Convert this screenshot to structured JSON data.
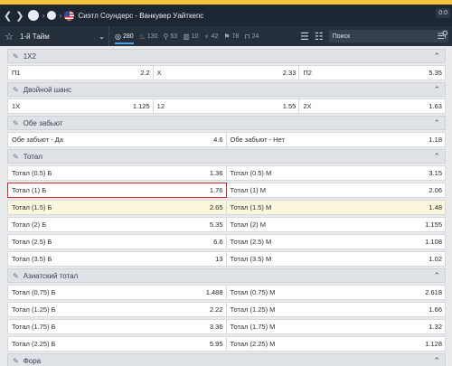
{
  "header": {
    "title": "Сиэтл Соундерс - Ванкувер Уайткепс",
    "timer": "0:0",
    "icons": [
      "chevron-left-icon",
      "chevron-right-icon",
      "sport-icon",
      "league-icon",
      "usa-flag-icon"
    ]
  },
  "toolbar": {
    "period_label": "1-й Тайм",
    "markets": [
      {
        "icon": "target-icon",
        "count": "280"
      },
      {
        "icon": "flame-icon",
        "count": "130"
      },
      {
        "icon": "stats-icon",
        "count": "53"
      },
      {
        "icon": "chart-icon",
        "count": "10"
      },
      {
        "icon": "trophy-icon",
        "count": "42"
      },
      {
        "icon": "flag-icon",
        "count": "78"
      },
      {
        "icon": "goal-icon",
        "count": "24"
      }
    ],
    "search_placeholder": "Поиск"
  },
  "sections": [
    {
      "title": "1X2",
      "rows": [
        [
          {
            "label": "П1",
            "odd": "2.2"
          },
          {
            "label": "Х",
            "odd": "2.33"
          },
          {
            "label": "П2",
            "odd": "5.35"
          }
        ]
      ]
    },
    {
      "title": "Двойной шанс",
      "rows": [
        [
          {
            "label": "1Х",
            "odd": "1.125"
          },
          {
            "label": "12",
            "odd": "1.55"
          },
          {
            "label": "2Х",
            "odd": "1.63"
          }
        ]
      ]
    },
    {
      "title": "Обе забьют",
      "rows": [
        [
          {
            "label": "Обе забьют - Да",
            "odd": "4.6"
          },
          {
            "label": "Обе забьют - Нет",
            "odd": "1.18"
          }
        ]
      ]
    },
    {
      "title": "Тотал",
      "rows": [
        [
          {
            "label": "Тотал (0.5) Б",
            "odd": "1.36"
          },
          {
            "label": "Тотал (0.5) М",
            "odd": "3.15"
          }
        ],
        [
          {
            "label": "Тотал (1) Б",
            "odd": "1.76"
          },
          {
            "label": "Тотал (1) М",
            "odd": "2.06"
          }
        ],
        [
          {
            "label": "Тотал (1.5) Б",
            "odd": "2.65"
          },
          {
            "label": "Тотал (1.5) М",
            "odd": "1.48"
          }
        ],
        [
          {
            "label": "Тотал (2) Б",
            "odd": "5.35"
          },
          {
            "label": "Тотал (2) М",
            "odd": "1.155"
          }
        ],
        [
          {
            "label": "Тотал (2.5) Б",
            "odd": "6.6"
          },
          {
            "label": "Тотал (2.5) М",
            "odd": "1.108"
          }
        ],
        [
          {
            "label": "Тотал (3.5) Б",
            "odd": "13"
          },
          {
            "label": "Тотал (3.5) М",
            "odd": "1.02"
          }
        ]
      ]
    },
    {
      "title": "Азиатский тотал",
      "rows": [
        [
          {
            "label": "Тотал (0.75) Б",
            "odd": "1.488"
          },
          {
            "label": "Тотал (0.75) М",
            "odd": "2.618"
          }
        ],
        [
          {
            "label": "Тотал (1.25) Б",
            "odd": "2.22"
          },
          {
            "label": "Тотал (1.25) М",
            "odd": "1.66"
          }
        ],
        [
          {
            "label": "Тотал (1.75) Б",
            "odd": "3.36"
          },
          {
            "label": "Тотал (1.75) М",
            "odd": "1.32"
          }
        ],
        [
          {
            "label": "Тотал (2.25) Б",
            "odd": "5.95"
          },
          {
            "label": "Тотал (2.25) М",
            "odd": "1.128"
          }
        ]
      ]
    },
    {
      "title": "Фора",
      "rows": []
    }
  ],
  "colors": {
    "header_bg": "#1d2733",
    "accent_strip": "#f4c53c",
    "selected_outline": "#d12b2b",
    "highlight_row": "#fbf7dc"
  }
}
